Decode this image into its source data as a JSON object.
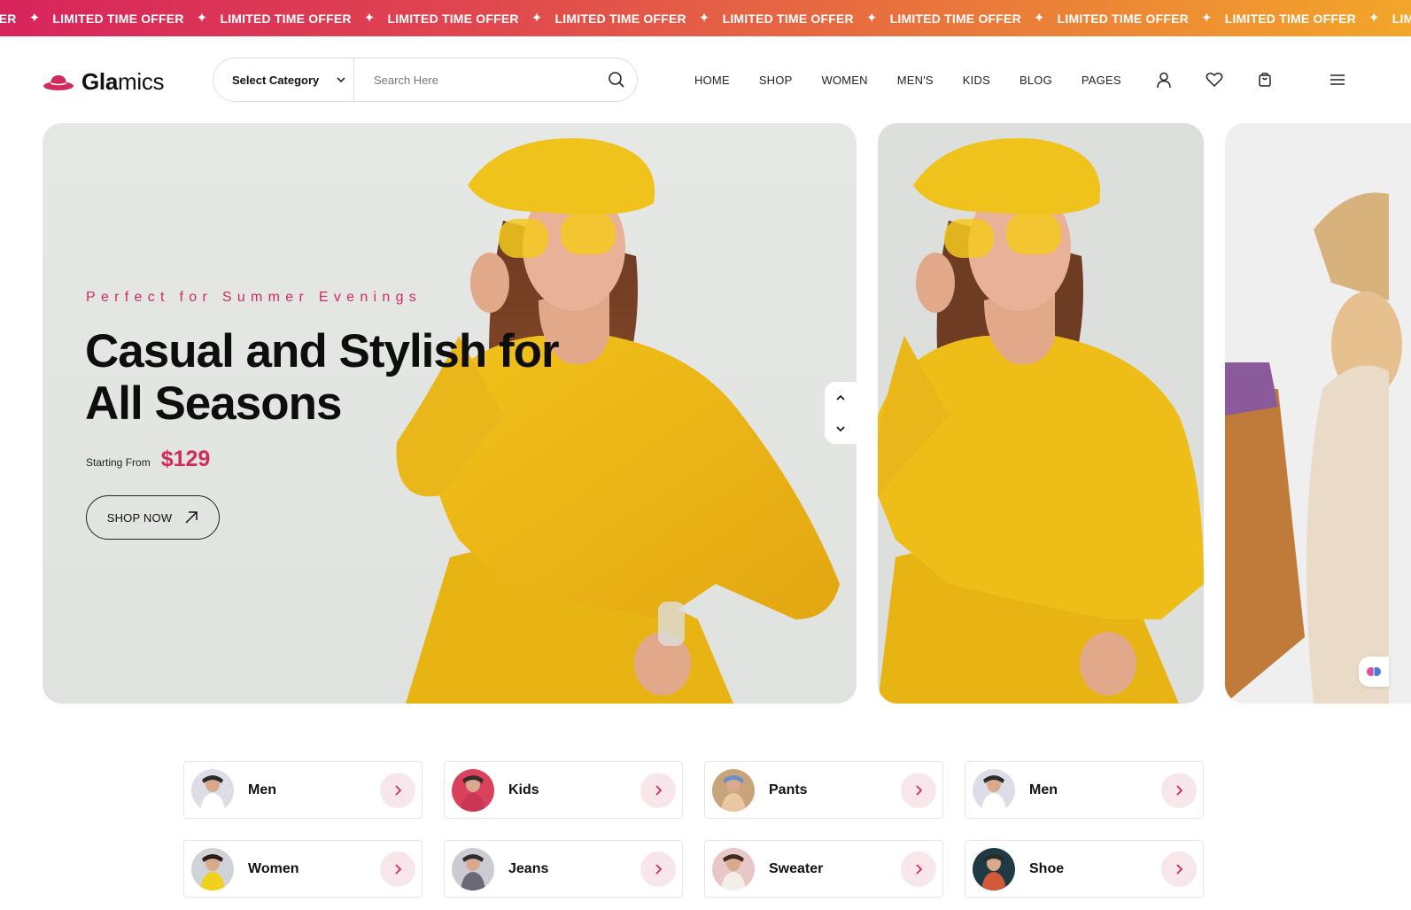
{
  "ticker": {
    "first_fragment": "FER",
    "items": [
      "LIMITED TIME OFFER",
      "LIMITED TIME OFFER",
      "LIMITED TIME OFFER",
      "LIMITED TIME OFFER",
      "LIMITED TIME OFFER",
      "LIMITED TIME OFFER",
      "LIMITED TIME OFFER",
      "LIMITED TIME OFFER",
      "LIMITED TIME OFFER",
      "LIMITED TIME OFFER"
    ],
    "separator_icon": "sparkle-star-icon",
    "gradient": [
      "#d7245d",
      "#f3a62a"
    ]
  },
  "header": {
    "brand_prefix": "Gla",
    "brand_suffix": "mics",
    "logo_icon": "hat-icon",
    "category_label": "Select Category",
    "search_placeholder": "Search Here",
    "nav": [
      "HOME",
      "SHOP",
      "WOMEN",
      "MEN'S",
      "KIDS",
      "BLOG",
      "PAGES"
    ],
    "icons": [
      "user-icon",
      "heart-icon",
      "bag-icon",
      "menu-icon"
    ]
  },
  "hero": {
    "eyebrow": "Perfect for Summer Evenings",
    "headline_line1": "Casual and Stylish for",
    "headline_line2": "All Seasons",
    "price_label": "Starting From",
    "price": "$129",
    "cta_label": "SHOP NOW",
    "accent": "#d12a5c"
  },
  "categories": [
    {
      "label": "Men"
    },
    {
      "label": "Kids"
    },
    {
      "label": "Pants"
    },
    {
      "label": "Men"
    },
    {
      "label": "Women"
    },
    {
      "label": "Jeans"
    },
    {
      "label": "Sweater"
    },
    {
      "label": "Shoe"
    }
  ]
}
